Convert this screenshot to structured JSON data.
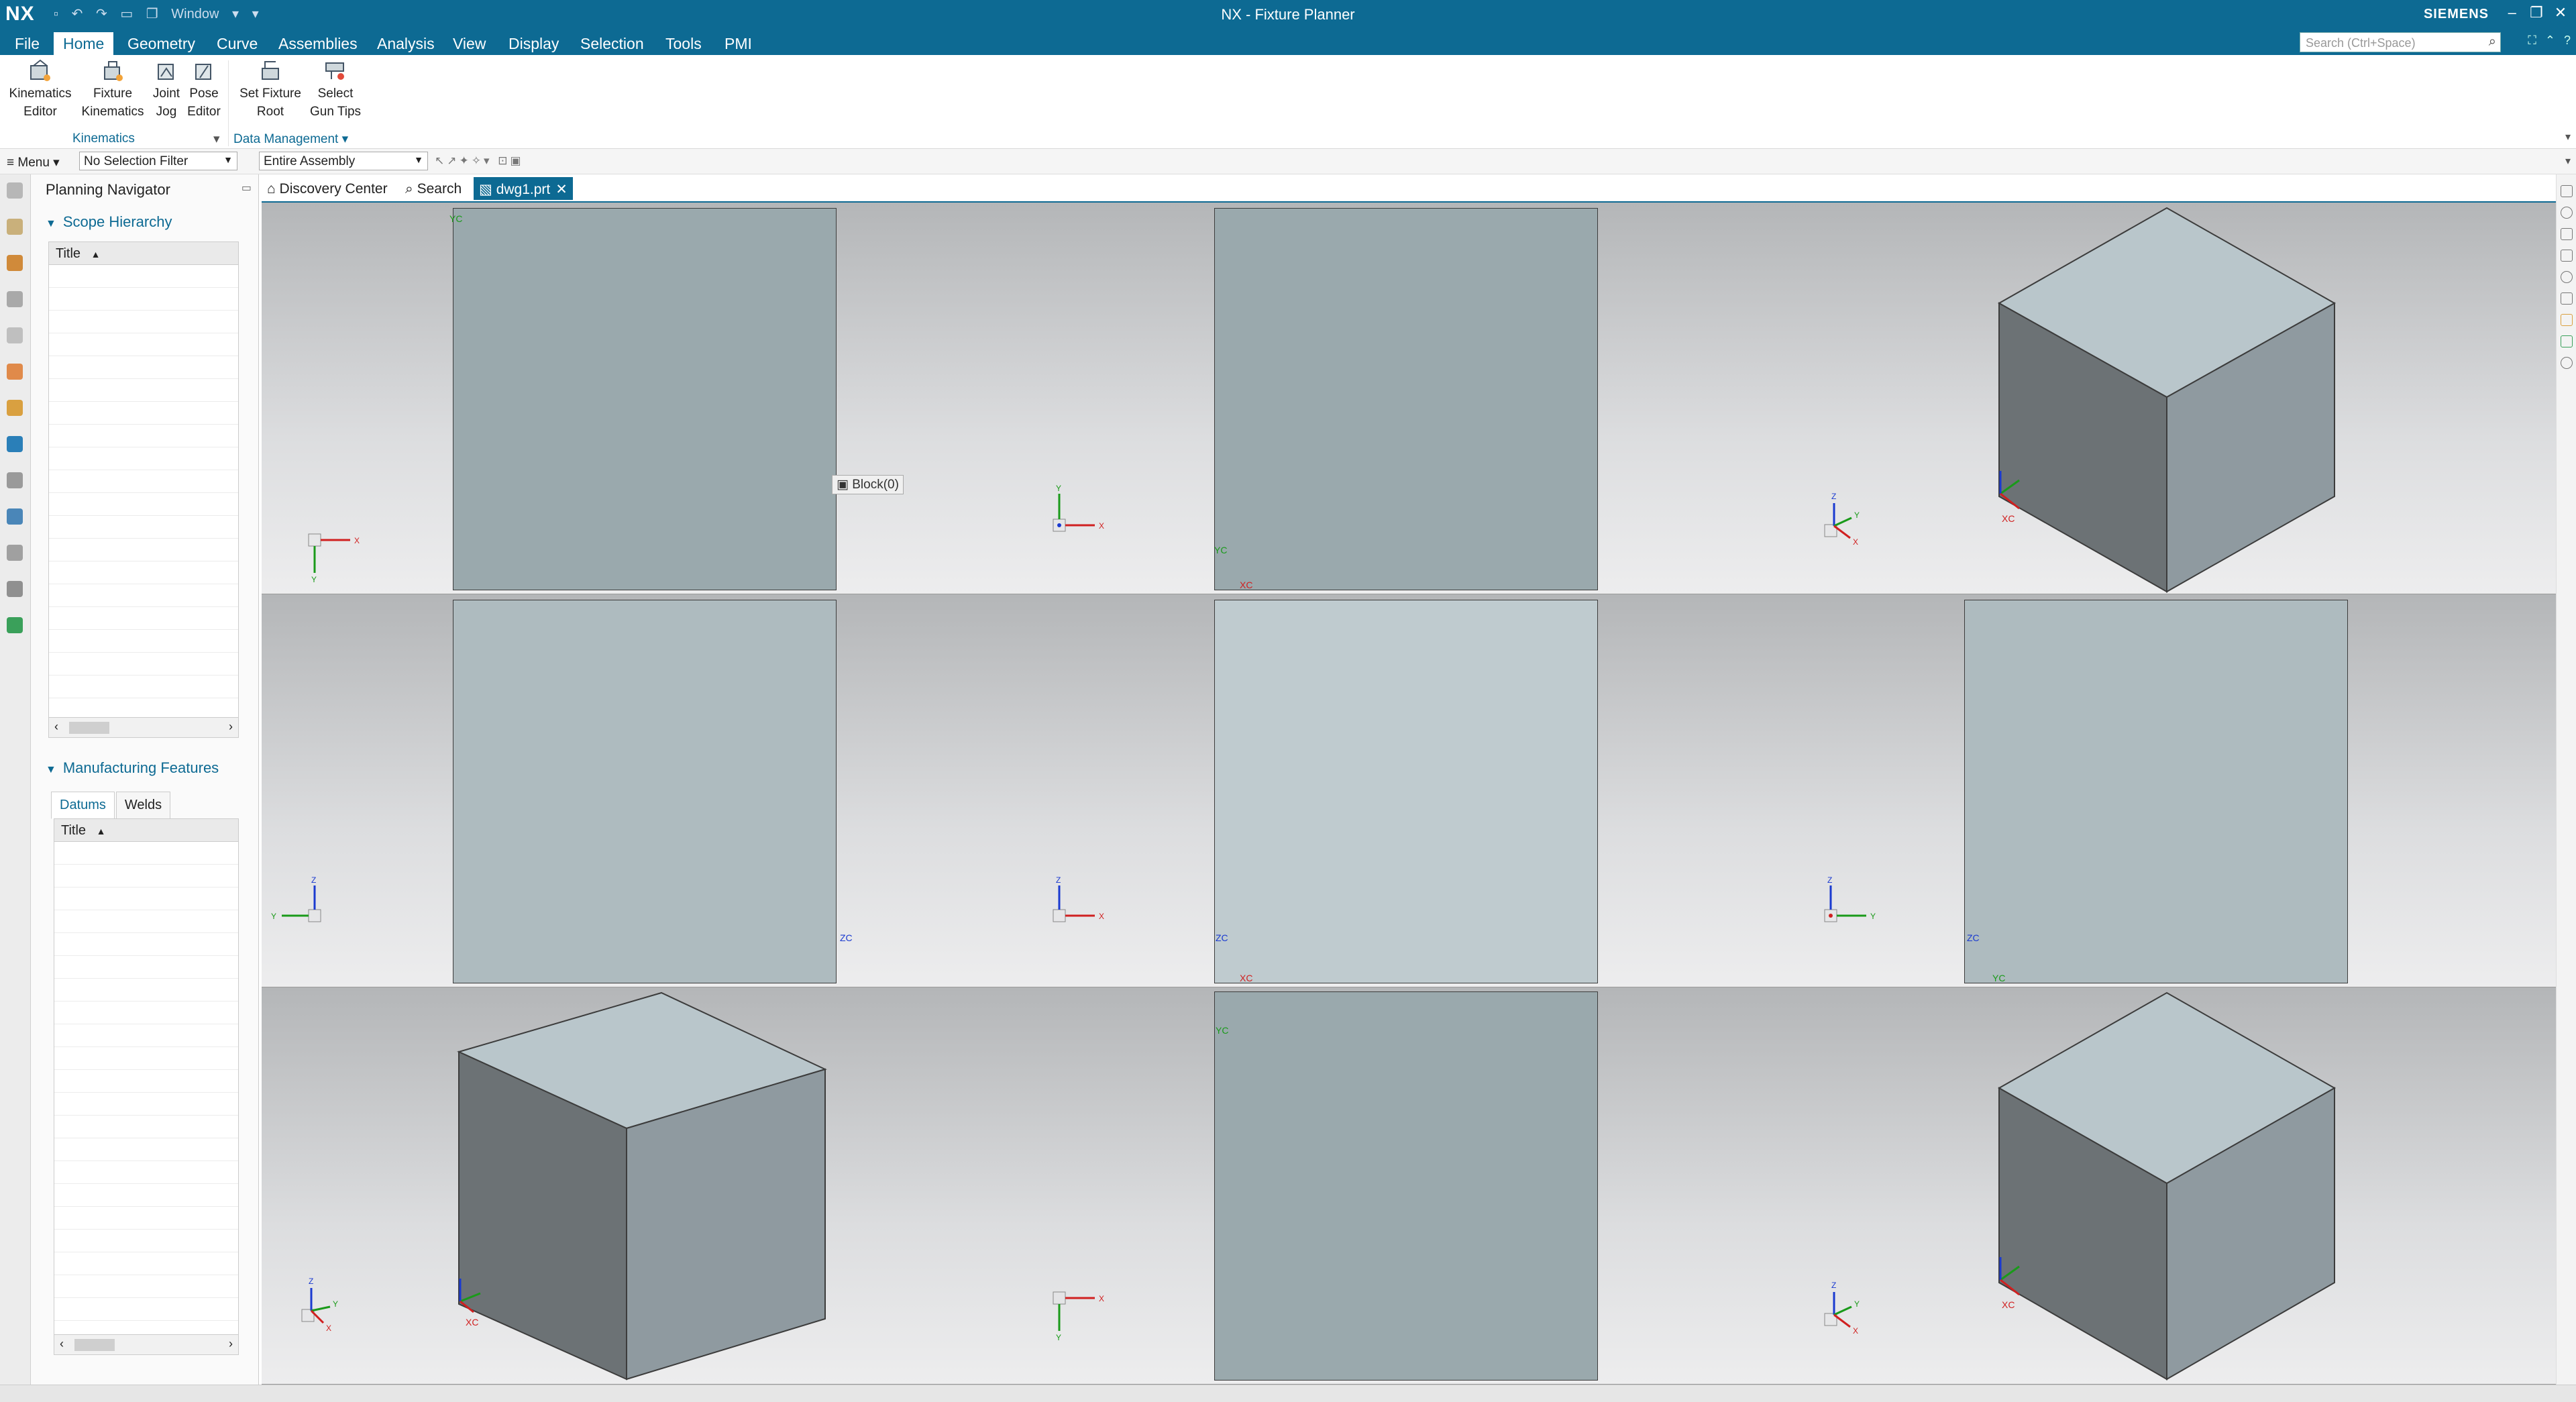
{
  "app": {
    "logo": "NX",
    "window_menu": "Window",
    "title": "NX - Fixture Planner",
    "brand": "SIEMENS"
  },
  "menu_tabs": [
    "File",
    "Home",
    "Geometry",
    "Curve",
    "Assemblies",
    "Analysis",
    "View",
    "Display",
    "Selection",
    "Tools",
    "PMI"
  ],
  "active_tab": "Home",
  "search": {
    "placeholder": "Search (Ctrl+Space)"
  },
  "ribbon": {
    "kinematics_editor": [
      "Kinematics",
      "Editor"
    ],
    "fixture_kinematics": [
      "Fixture",
      "Kinematics"
    ],
    "joint_jog": [
      "Joint",
      "Jog"
    ],
    "pose_editor": [
      "Pose",
      "Editor"
    ],
    "set_fixture_root": [
      "Set Fixture",
      "Root"
    ],
    "select_gun_tips": [
      "Select",
      "Gun Tips"
    ],
    "groups": [
      "Kinematics",
      "Data Management"
    ]
  },
  "filterbar": {
    "menu": "Menu",
    "selection_filter": "No Selection Filter",
    "scope": "Entire Assembly"
  },
  "navigator": {
    "title": "Planning Navigator",
    "scope_hierarchy": "Scope Hierarchy",
    "col_title": "Title",
    "manufacturing_features": "Manufacturing Features",
    "subtabs": [
      "Datums",
      "Welds"
    ],
    "col_title2": "Title"
  },
  "doc_tabs": [
    "Discovery Center",
    "Search",
    "dwg1.prt"
  ],
  "graphics": {
    "tooltip": "Block(0)",
    "axes": {
      "x": "X",
      "y": "Y",
      "z": "Z",
      "xc": "XC",
      "yc": "YC",
      "zc": "ZC"
    }
  },
  "colors": {
    "header": "#0d6a93",
    "face_dark": "#6c7275",
    "face_mid": "#8f9aa0",
    "face_top": "#b9c6cb",
    "axis_x": "#d02020",
    "axis_y": "#1a9a1a",
    "axis_z": "#1a3ad0"
  }
}
